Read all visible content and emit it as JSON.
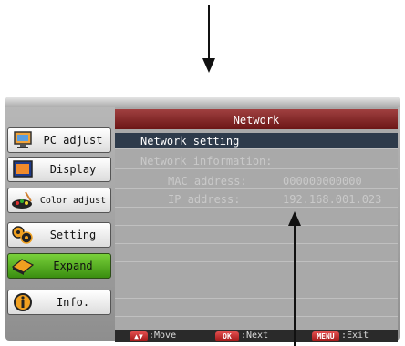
{
  "sidebar": {
    "items": [
      {
        "label": "PC adjust",
        "icon": "monitor-icon",
        "active": false
      },
      {
        "label": "Display",
        "icon": "display-icon",
        "active": false
      },
      {
        "label": "Color adjust",
        "icon": "palette-icon",
        "active": false
      },
      {
        "label": "Setting",
        "icon": "gears-icon",
        "active": false
      },
      {
        "label": "Expand",
        "icon": "expand-icon",
        "active": true
      },
      {
        "label": "Info.",
        "icon": "info-icon",
        "active": false
      }
    ]
  },
  "panel": {
    "title": "Network",
    "rows": [
      {
        "label": "Network setting",
        "value": "",
        "selected": true
      },
      {
        "label": "Network information:",
        "value": "",
        "selected": false
      },
      {
        "label": "MAC address:",
        "value": "000000000000",
        "selected": false
      },
      {
        "label": "IP address:",
        "value": "192.168.001.023",
        "selected": false
      }
    ]
  },
  "footer": {
    "move_key": "▲▼",
    "move_label": ":Move",
    "ok_key": "OK",
    "ok_label": ":Next",
    "menu_key": "MENU",
    "menu_label": ":Exit"
  },
  "colors": {
    "title_bar": "#8a2020",
    "selected_row": "#2e3b4b",
    "active_item": "#4aa81a",
    "key_badge": "#c42a2a"
  }
}
